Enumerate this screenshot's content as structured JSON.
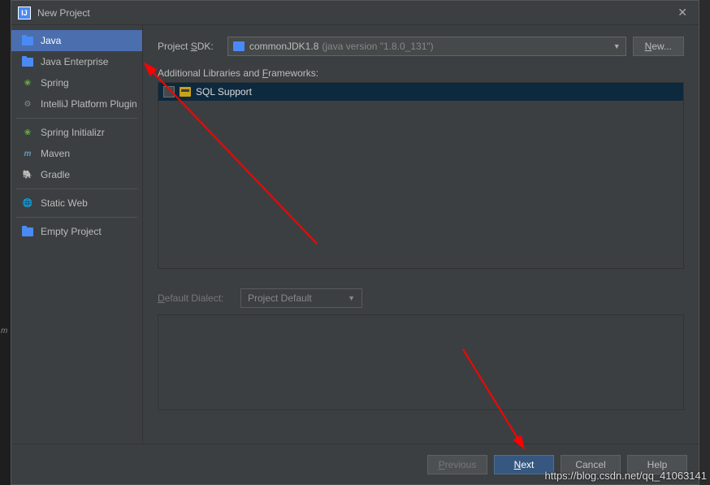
{
  "title": "New Project",
  "sidebar": {
    "items": [
      {
        "label": "Java",
        "icon": "folder"
      },
      {
        "label": "Java Enterprise",
        "icon": "folder-gear"
      },
      {
        "label": "Spring",
        "icon": "leaf"
      },
      {
        "label": "IntelliJ Platform Plugin",
        "icon": "gear"
      },
      {
        "label": "Spring Initializr",
        "icon": "leaf"
      },
      {
        "label": "Maven",
        "icon": "m"
      },
      {
        "label": "Gradle",
        "icon": "elephant"
      },
      {
        "label": "Static Web",
        "icon": "globe"
      },
      {
        "label": "Empty Project",
        "icon": "folder"
      }
    ]
  },
  "sdk": {
    "label_before": "Project ",
    "label_ul": "S",
    "label_after": "DK:",
    "name": "commonJDK1.8",
    "version": "(java version \"1.8.0_131\")",
    "new_btn_ul": "N",
    "new_btn_after": "ew..."
  },
  "libs": {
    "label_before": "Additional Libraries and ",
    "label_ul": "F",
    "label_after": "rameworks:",
    "items": [
      {
        "label": "SQL Support"
      }
    ]
  },
  "dialect": {
    "label_ul": "D",
    "label_after": "efault Dialect:",
    "value": "Project Default"
  },
  "footer": {
    "previous_ul": "P",
    "previous_after": "revious",
    "next_ul": "N",
    "next_after": "ext",
    "cancel": "Cancel",
    "help": "Help"
  },
  "watermark": "https://blog.csdn.net/qq_41063141"
}
